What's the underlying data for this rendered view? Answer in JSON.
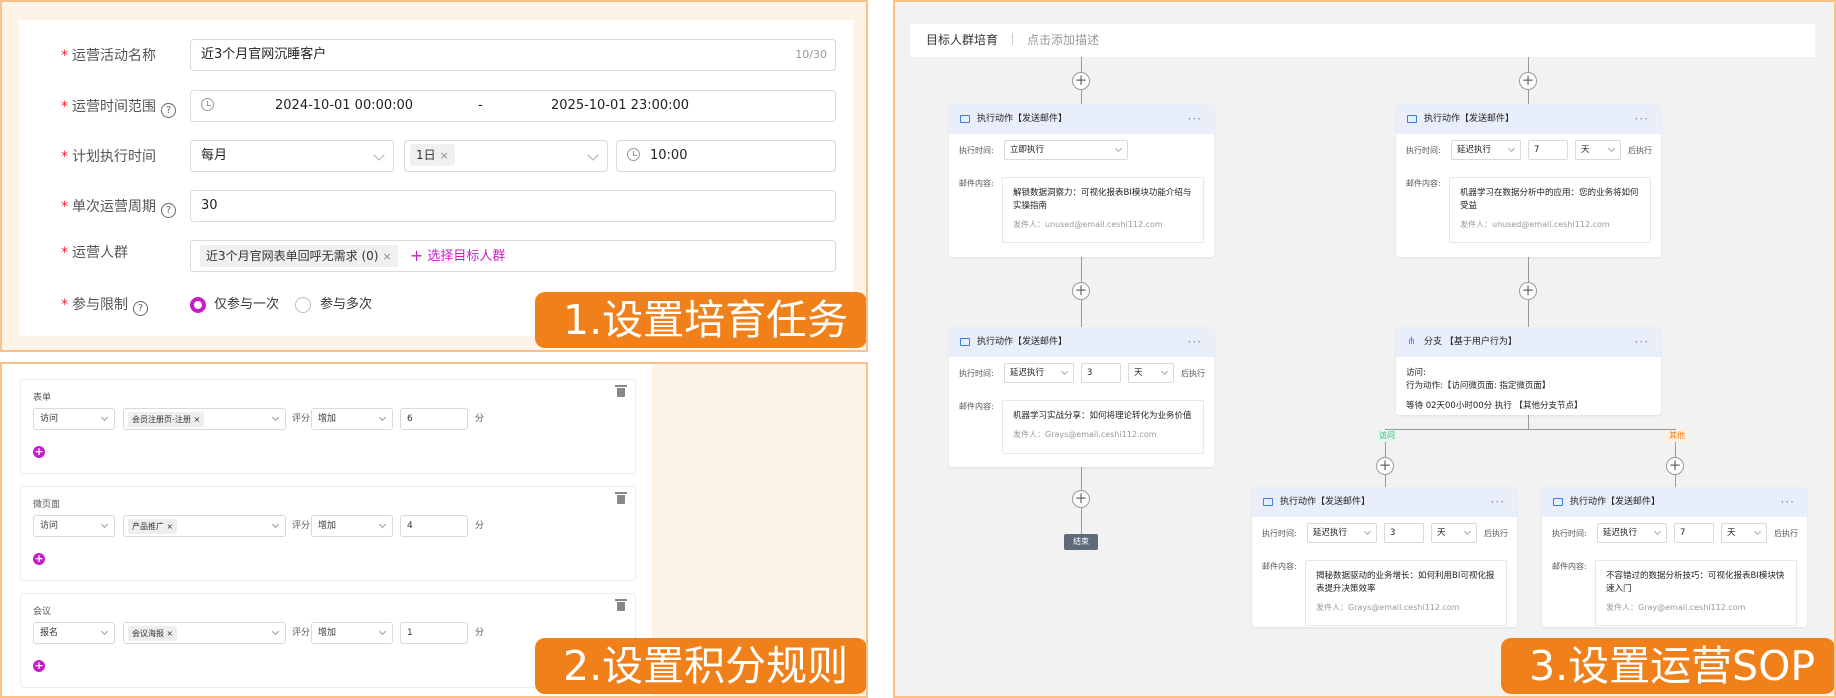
{
  "form": {
    "activity_name_label": "运营活动名称",
    "activity_name_value": "近3个月官网沉睡客户",
    "activity_name_count": "10/30",
    "time_range_label": "运营时间范围",
    "time_start": "2024-10-01 00:00:00",
    "time_sep": "-",
    "time_end": "2025-10-01 23:00:00",
    "plan_time_label": "计划执行时间",
    "plan_freq": "每月",
    "plan_day_tag": "1日",
    "plan_clock": "10:00",
    "cycle_label": "单次运营周期",
    "cycle_value": "30",
    "crowd_label": "运营人群",
    "crowd_tag": "近3个月官网表单回呼无需求 (0)",
    "crowd_select": "选择目标人群",
    "limit_label": "参与限制",
    "limit_once": "仅参与一次",
    "limit_multi": "参与多次",
    "required_mark": "*",
    "help_mark": "?",
    "tag_close": "×"
  },
  "step_labels": {
    "step1": "1.设置培育任务",
    "step2": "2.设置积分规则",
    "step3": "3.设置运营SOP"
  },
  "rules": [
    {
      "title": "表单",
      "action": "访问",
      "target": "会员注册页-注册",
      "score_label": "评分",
      "op": "增加",
      "value": "6",
      "unit": "分"
    },
    {
      "title": "微页面",
      "action": "访问",
      "target": "产品推广",
      "score_label": "评分",
      "op": "增加",
      "value": "4",
      "unit": "分"
    },
    {
      "title": "会议",
      "action": "报名",
      "target": "会议海报",
      "score_label": "评分",
      "op": "增加",
      "value": "1",
      "unit": "分"
    }
  ],
  "flow": {
    "header_title": "目标人群培育",
    "header_desc": "点击添加描述",
    "action_title": "执行动作【发送邮件】",
    "exec_time_label": "执行时间:",
    "mail_content_label": "邮件内容:",
    "after_exec": "后执行",
    "day_unit": "天",
    "more": "···",
    "node1": {
      "mode": "立即执行",
      "subject": "解锁数据洞察力：可视化报表BI模块功能介绍与实操指南",
      "from": "发件人：unused@email.ceshi112.com"
    },
    "node2": {
      "mode": "延迟执行",
      "days": "3",
      "subject": "机器学习实战分享：如何将理论转化为业务价值",
      "from": "发件人：Grays@email.ceshi112.com"
    },
    "node3": {
      "mode": "延迟执行",
      "days": "7",
      "subject": "机器学习在数据分析中的应用：您的业务将如何受益",
      "from": "发件人：unused@email.ceshi112.com"
    },
    "branch": {
      "title": "分支 【基于用户行为】",
      "line1": "访问:",
      "line2": "行为动作:【访问微页面: 指定微页面】",
      "line3": "等待  02天00小时00分  执行  【其他分支节点】"
    },
    "branch_visit": "访问",
    "branch_other": "其他",
    "node4": {
      "mode": "延迟执行",
      "days": "3",
      "subject": "揭秘数据驱动的业务增长：如何利用BI可视化报表提升决策效率",
      "from": "发件人：Grays@email.ceshi112.com"
    },
    "node5": {
      "mode": "延迟执行",
      "days": "7",
      "subject": "不容错过的数据分析技巧：可视化报表BI模块快速入门",
      "from": "发件人：Gray@email.ceshi112.com"
    },
    "end_label": "结束",
    "add_mark": "+"
  },
  "colors": {
    "accent_orange": "#f08019",
    "panel_border": "#f9c088",
    "brand_magenta": "#c81ec8",
    "node_header": "#e9eefb"
  }
}
